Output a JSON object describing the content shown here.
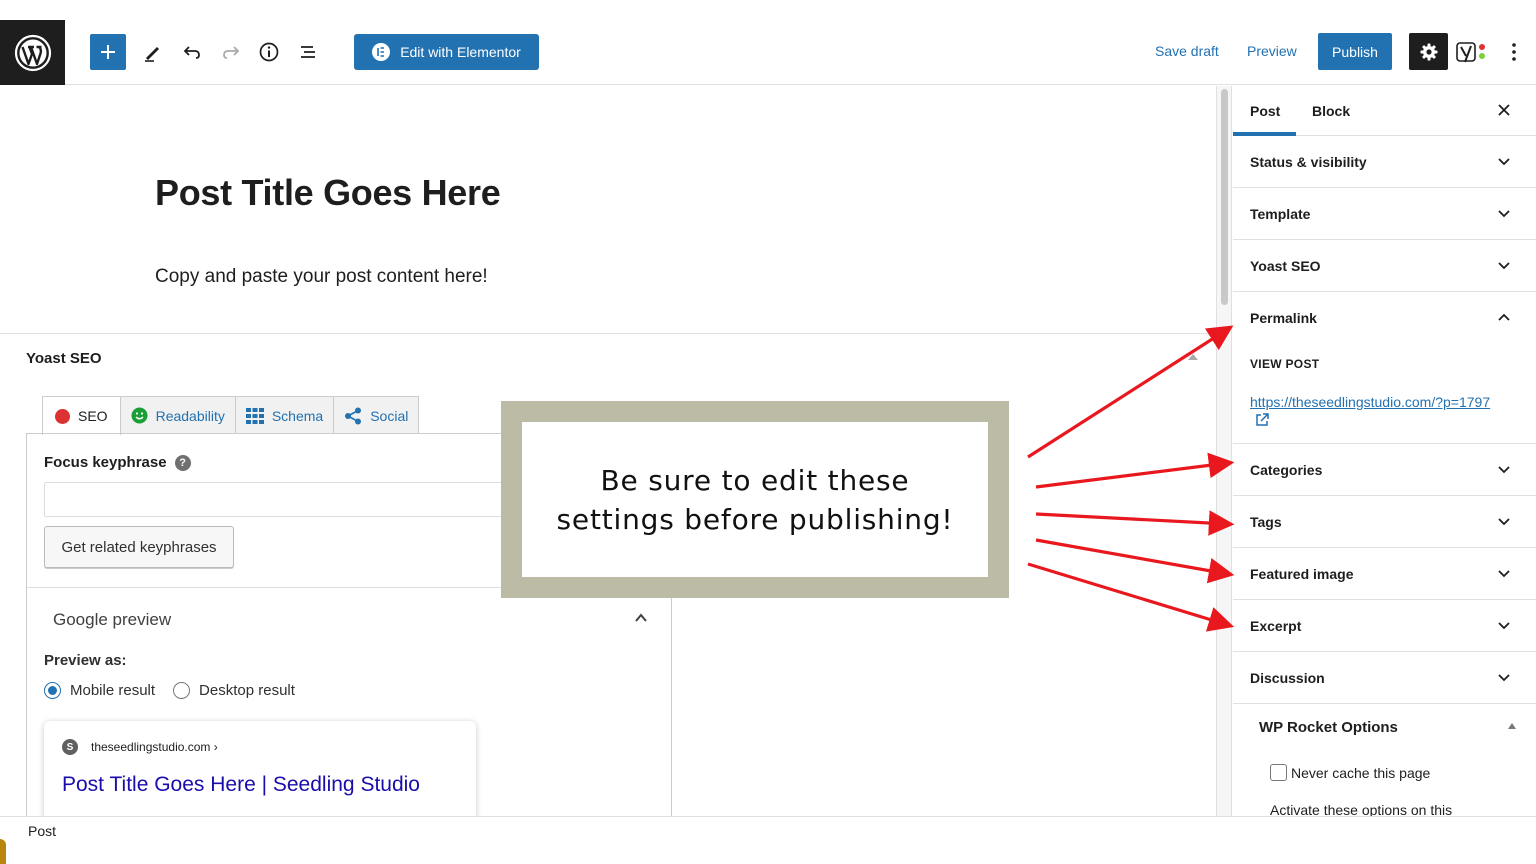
{
  "toolbar": {
    "elementor_label": "Edit with Elementor",
    "save_draft": "Save draft",
    "preview": "Preview",
    "publish": "Publish",
    "accent_color": "#2271b1"
  },
  "editor": {
    "post_title": "Post Title Goes Here",
    "post_content": "Copy and paste your post content here!"
  },
  "yoast": {
    "heading": "Yoast SEO",
    "tabs": [
      {
        "label": "SEO",
        "icon": "red-dot-icon"
      },
      {
        "label": "Readability",
        "icon": "smiley-icon"
      },
      {
        "label": "Schema",
        "icon": "grid-icon"
      },
      {
        "label": "Social",
        "icon": "share-icon"
      }
    ],
    "focus_keyphrase_label": "Focus keyphrase",
    "focus_keyphrase_value": "",
    "related_button": "Get related keyphrases",
    "google_preview": "Google preview",
    "preview_as": "Preview as:",
    "mobile_result": "Mobile result",
    "desktop_result": "Desktop result",
    "serp": {
      "url": "theseedlingstudio.com ›",
      "title": "Post Title Goes Here | Seedling Studio"
    }
  },
  "callout": {
    "line1": "Be sure to edit these",
    "line2": "settings before publishing!",
    "arrow_color": "#e8181e"
  },
  "sidebar": {
    "tab_post": "Post",
    "tab_block": "Block",
    "panels": [
      "Status & visibility",
      "Template",
      "Yoast SEO",
      "Permalink",
      "Categories",
      "Tags",
      "Featured image",
      "Excerpt",
      "Discussion"
    ],
    "view_post": "VIEW POST",
    "permalink_url": "https://theseedlingstudio.com/?p=1797",
    "rocket_heading": "WP Rocket Options",
    "never_cache": "Never cache this page",
    "activate_text": "Activate these options on this"
  },
  "footer": {
    "breadcrumb": "Post"
  }
}
